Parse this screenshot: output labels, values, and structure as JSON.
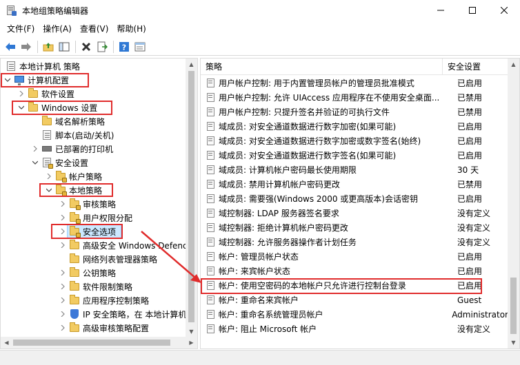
{
  "window": {
    "title": "本地组策略编辑器"
  },
  "menu": [
    "文件(F)",
    "操作(A)",
    "查看(V)",
    "帮助(H)"
  ],
  "tree": {
    "root": "本地计算机 策略",
    "computer_config": "计算机配置",
    "software_settings": "软件设置",
    "windows_settings": "Windows 设置",
    "dns_policy": "域名解析策略",
    "scripts": "脚本(启动/关机)",
    "printers": "已部署的打印机",
    "security_settings": "安全设置",
    "account_policies": "帐户策略",
    "local_policies": "本地策略",
    "audit_policy": "审核策略",
    "user_rights": "用户权限分配",
    "security_options": "安全选项",
    "defender_firewall": "高级安全 Windows Defender",
    "network_list": "网络列表管理器策略",
    "public_key": "公钥策略",
    "software_restriction": "软件限制策略",
    "app_control": "应用程序控制策略",
    "ipsec": "IP 安全策略，在 本地计算机",
    "advanced_audit": "高级审核策略配置"
  },
  "list": {
    "col_policy": "策略",
    "col_setting": "安全设置",
    "rows": [
      {
        "name": "用户帐户控制: 用于内置管理员帐户的管理员批准模式",
        "value": "已启用"
      },
      {
        "name": "用户帐户控制: 允许 UIAccess 应用程序在不使用安全桌面...",
        "value": "已禁用"
      },
      {
        "name": "用户帐户控制: 只提升签名并验证的可执行文件",
        "value": "已禁用"
      },
      {
        "name": "域成员: 对安全通道数据进行数字加密(如果可能)",
        "value": "已启用"
      },
      {
        "name": "域成员: 对安全通道数据进行数字加密或数字签名(始终)",
        "value": "已启用"
      },
      {
        "name": "域成员: 对安全通道数据进行数字签名(如果可能)",
        "value": "已启用"
      },
      {
        "name": "域成员: 计算机帐户密码最长使用期限",
        "value": "30 天"
      },
      {
        "name": "域成员: 禁用计算机帐户密码更改",
        "value": "已禁用"
      },
      {
        "name": "域成员: 需要强(Windows 2000 或更高版本)会话密钥",
        "value": "已启用"
      },
      {
        "name": "域控制器: LDAP 服务器签名要求",
        "value": "没有定义"
      },
      {
        "name": "域控制器: 拒绝计算机帐户密码更改",
        "value": "没有定义"
      },
      {
        "name": "域控制器: 允许服务器操作者计划任务",
        "value": "没有定义"
      },
      {
        "name": "帐户: 管理员帐户状态",
        "value": "已启用"
      },
      {
        "name": "帐户: 来宾帐户状态",
        "value": "已启用"
      },
      {
        "name": "帐户: 使用空密码的本地帐户只允许进行控制台登录",
        "value": "已启用"
      },
      {
        "name": "帐户: 重命名来宾帐户",
        "value": "Guest"
      },
      {
        "name": "帐户: 重命名系统管理员帐户",
        "value": "Administrator"
      },
      {
        "name": "帐户: 阻止 Microsoft 帐户",
        "value": "没有定义"
      }
    ]
  },
  "colors": {
    "highlight": "#e02b2b",
    "selection": "#cce8ff"
  }
}
